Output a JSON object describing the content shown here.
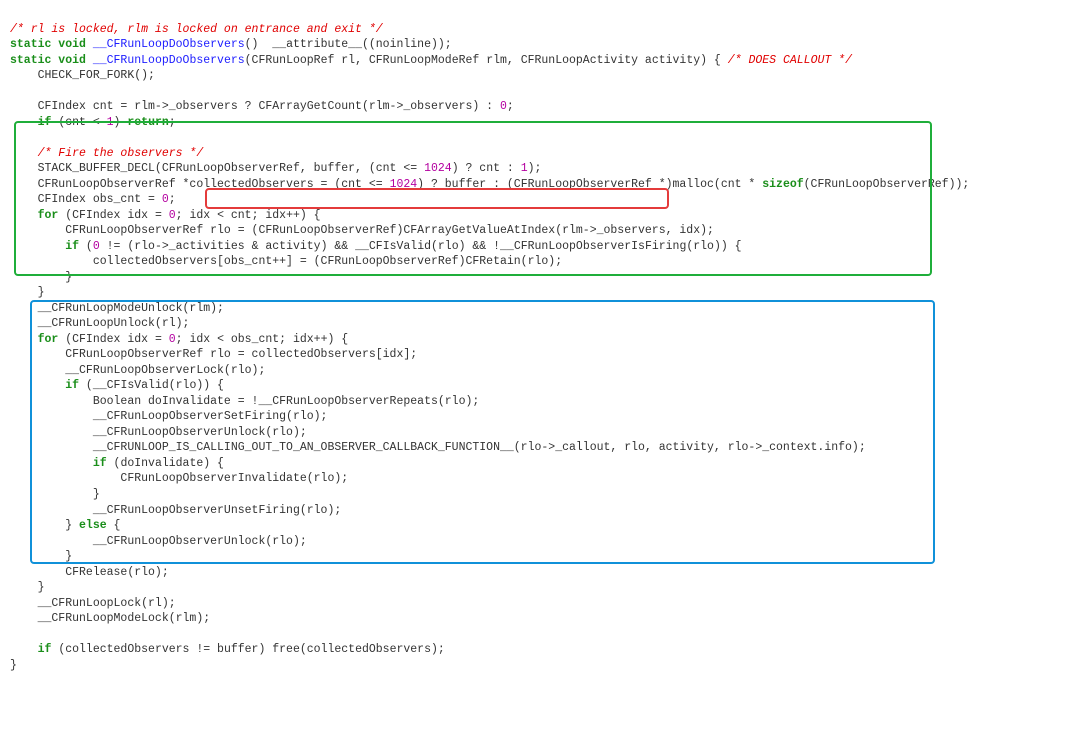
{
  "c1": "/* rl is locked, rlm is locked on entrance and exit */",
  "l2a": "static void",
  "l2b": "__CFRunLoopDoObservers",
  "l2c": "()  __attribute__((noinline));",
  "l3a": "static void",
  "l3b": "__CFRunLoopDoObservers",
  "l3c": "(CFRunLoopRef rl, CFRunLoopModeRef rlm, CFRunLoopActivity activity) { ",
  "l3d": "/* DOES CALLOUT */",
  "l4": "    CHECK_FOR_FORK();",
  "blank": "",
  "l6a": "    CFIndex cnt = rlm->_observers ? CFArrayGetCount(rlm->_observers) : ",
  "l6n": "0",
  "l6b": ";",
  "l7a": "    ",
  "l7if": "if",
  "l7b": " (cnt < ",
  "l7n": "1",
  "l7c": ") ",
  "l7ret": "return",
  "l7d": ";",
  "l9": "    /* Fire the observers */",
  "l10a": "    STACK_BUFFER_DECL(CFRunLoopObserverRef, buffer, (cnt <= ",
  "l10n": "1024",
  "l10b": ") ? cnt : ",
  "l10n2": "1",
  "l10c": ");",
  "l11a": "    CFRunLoopObserverRef *collectedObservers = (cnt <= ",
  "l11n": "1024",
  "l11b": ") ? buffer : (CFRunLoopObserverRef *)malloc(cnt * ",
  "l11sz": "sizeof",
  "l11c": "(CFRunLoopObserverRef));",
  "l12a": "    CFIndex obs_cnt = ",
  "l12n": "0",
  "l12b": ";",
  "l13a": "    ",
  "l13for": "for",
  "l13b": " (CFIndex idx = ",
  "l13n": "0",
  "l13c": "; idx < cnt; idx++) {",
  "l14": "        CFRunLoopObserverRef rlo = (CFRunLoopObserverRef)CFArrayGetValueAtIndex(rlm->_observers, idx);",
  "l15a": "        ",
  "l15if": "if",
  "l15b": " (",
  "l15n": "0",
  "l15c": " != (rlo->_activities & activity) && __CFIsValid(rlo) && !__CFRunLoopObserverIsFiring(rlo)) {",
  "l16": "            collectedObservers[obs_cnt++] = (CFRunLoopObserverRef)CFRetain(rlo);",
  "l17": "        }",
  "l18": "    }",
  "l19": "    __CFRunLoopModeUnlock(rlm);",
  "l20": "    __CFRunLoopUnlock(rl);",
  "l21a": "    ",
  "l21for": "for",
  "l21b": " (CFIndex idx = ",
  "l21n": "0",
  "l21c": "; idx < obs_cnt; idx++) {",
  "l22": "        CFRunLoopObserverRef rlo = collectedObservers[idx];",
  "l23": "        __CFRunLoopObserverLock(rlo);",
  "l24a": "        ",
  "l24if": "if",
  "l24b": " (__CFIsValid(rlo)) {",
  "l25": "            Boolean doInvalidate = !__CFRunLoopObserverRepeats(rlo);",
  "l26": "            __CFRunLoopObserverSetFiring(rlo);",
  "l27": "            __CFRunLoopObserverUnlock(rlo);",
  "l28": "            __CFRUNLOOP_IS_CALLING_OUT_TO_AN_OBSERVER_CALLBACK_FUNCTION__(rlo->_callout, rlo, activity, rlo->_context.info);",
  "l29a": "            ",
  "l29if": "if",
  "l29b": " (doInvalidate) {",
  "l30": "                CFRunLoopObserverInvalidate(rlo);",
  "l31": "            }",
  "l32": "            __CFRunLoopObserverUnsetFiring(rlo);",
  "l33a": "        } ",
  "l33else": "else",
  "l33b": " {",
  "l34": "            __CFRunLoopObserverUnlock(rlo);",
  "l35": "        }",
  "l36": "        CFRelease(rlo);",
  "l37": "    }",
  "l38": "    __CFRunLoopLock(rl);",
  "l39": "    __CFRunLoopModeLock(rlm);",
  "l41a": "    ",
  "l41if": "if",
  "l41b": " (collectedObservers != buffer) free(collectedObservers);",
  "l42": "}"
}
